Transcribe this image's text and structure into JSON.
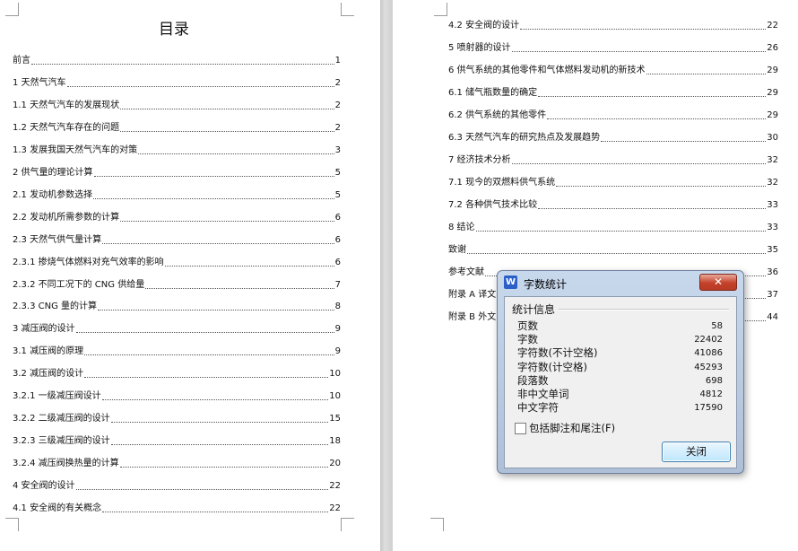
{
  "left_page": {
    "title": "目录",
    "entries": [
      {
        "text": "前言",
        "page": "1"
      },
      {
        "text": "1 天然气汽车",
        "page": "2"
      },
      {
        "text": "1.1 天然气汽车的发展现状",
        "page": "2"
      },
      {
        "text": "1.2 天然气汽车存在的问题",
        "page": "2"
      },
      {
        "text": "1.3 发展我国天然气汽车的对策",
        "page": "3"
      },
      {
        "text": "2 供气量的理论计算",
        "page": "5"
      },
      {
        "text": "2.1 发动机参数选择",
        "page": "5"
      },
      {
        "text": "2.2 发动机所需参数的计算",
        "page": "6"
      },
      {
        "text": "2.3 天然气供气量计算",
        "page": "6"
      },
      {
        "text": "2.3.1 掺烧气体燃料对充气效率的影响",
        "page": "6"
      },
      {
        "text": "2.3.2 不同工况下的 CNG 供给量",
        "page": "7"
      },
      {
        "text": "2.3.3 CNG 量的计算",
        "page": "8"
      },
      {
        "text": "3 减压阀的设计",
        "page": "9"
      },
      {
        "text": "3.1 减压阀的原理",
        "page": "9"
      },
      {
        "text": "3.2 减压阀的设计",
        "page": "10"
      },
      {
        "text": "3.2.1 一级减压阀设计",
        "page": "10"
      },
      {
        "text": "3.2.2 二级减压阀的设计",
        "page": "15"
      },
      {
        "text": "3.2.3 三级减压阀的设计",
        "page": "18"
      },
      {
        "text": "3.2.4 减压阀换热量的计算",
        "page": "20"
      },
      {
        "text": "4 安全阀的设计",
        "page": "22"
      },
      {
        "text": "4.1 安全阀的有关概念",
        "page": "22"
      }
    ]
  },
  "right_page": {
    "entries": [
      {
        "text": "4.2 安全阀的设计",
        "page": "22"
      },
      {
        "text": "5 喷射器的设计",
        "page": "26"
      },
      {
        "text": "6 供气系统的其他零件和气体燃料发动机的新技术",
        "page": "29"
      },
      {
        "text": "6.1 储气瓶数量的确定",
        "page": "29"
      },
      {
        "text": "6.2 供气系统的其他零件",
        "page": "29"
      },
      {
        "text": "6.3 天然气汽车的研究热点及发展趋势",
        "page": "30"
      },
      {
        "text": "7 经济技术分析",
        "page": "32"
      },
      {
        "text": "7.1 现今的双燃料供气系统",
        "page": "32"
      },
      {
        "text": "7.2 各种供气技术比较",
        "page": "33"
      },
      {
        "text": "8 结论",
        "page": "33"
      },
      {
        "text": "致谢",
        "page": "35"
      },
      {
        "text": "参考文献",
        "page": "36"
      },
      {
        "text": "附录 A 译文",
        "page": "37"
      },
      {
        "text": "附录 B 外文",
        "page": "44"
      }
    ]
  },
  "dialog": {
    "icon_letter": "W",
    "title": "字数统计",
    "close_glyph": "✕",
    "group_label": "统计信息",
    "stats": [
      {
        "label": "页数",
        "value": "58"
      },
      {
        "label": "字数",
        "value": "22402"
      },
      {
        "label": "字符数(不计空格)",
        "value": "41086"
      },
      {
        "label": "字符数(计空格)",
        "value": "45293"
      },
      {
        "label": "段落数",
        "value": "698"
      },
      {
        "label": "非中文单词",
        "value": "4812"
      },
      {
        "label": "中文字符",
        "value": "17590"
      }
    ],
    "checkbox_label": "包括脚注和尾注(F)",
    "close_button": "关闭"
  },
  "colors": {
    "dialog_frame": "#aebfd8",
    "close_red": "#c5412a",
    "button_blue": "#bee6fd"
  }
}
